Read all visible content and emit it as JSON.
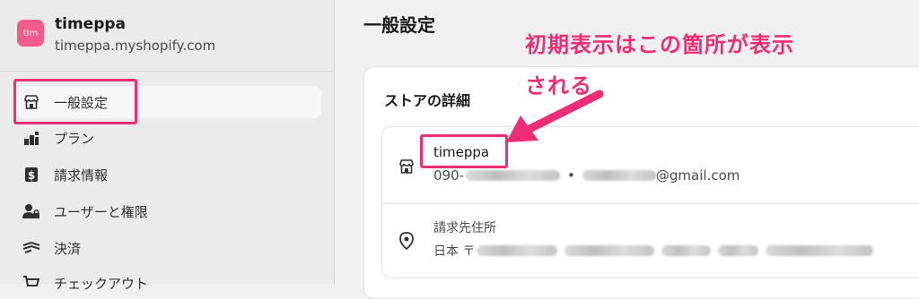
{
  "store": {
    "avatar_text": "tim",
    "name": "timeppa",
    "domain": "timeppa.myshopify.com"
  },
  "sidebar": {
    "items": [
      {
        "label": "一般設定",
        "icon": "store-icon",
        "active": true
      },
      {
        "label": "プラン",
        "icon": "plan-chart-icon",
        "active": false
      },
      {
        "label": "請求情報",
        "icon": "billing-dollar-icon",
        "active": false
      },
      {
        "label": "ユーザーと権限",
        "icon": "users-icon",
        "active": false
      },
      {
        "label": "決済",
        "icon": "payments-icon",
        "active": false
      },
      {
        "label": "チェックアウト",
        "icon": "cart-icon",
        "active": false
      }
    ]
  },
  "main": {
    "page_title": "一般設定",
    "card_title": "ストアの詳細",
    "store_name": "timeppa",
    "phone_prefix": "090-",
    "separator": "•",
    "email_suffix": "@gmail.com",
    "billing_label": "請求先住所",
    "address_prefix": "日本 〒"
  },
  "annotation": {
    "line1": "初期表示はこの箇所が表示",
    "line2": "される"
  },
  "colors": {
    "accent": "#ef2d74",
    "avatar": "#f45c8e"
  }
}
